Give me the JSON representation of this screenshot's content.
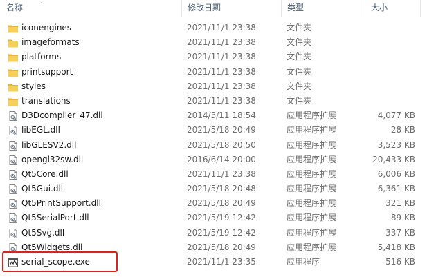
{
  "columns": {
    "name": "名称",
    "date": "修改日期",
    "type": "类型",
    "size": "大小"
  },
  "files": [
    {
      "name": "iconengines",
      "date": "2021/11/1 23:38",
      "type": "文件夹",
      "size": "",
      "icon": "folder-icon"
    },
    {
      "name": "imageformats",
      "date": "2021/11/1 23:38",
      "type": "文件夹",
      "size": "",
      "icon": "folder-icon"
    },
    {
      "name": "platforms",
      "date": "2021/11/1 23:38",
      "type": "文件夹",
      "size": "",
      "icon": "folder-icon"
    },
    {
      "name": "printsupport",
      "date": "2021/11/1 23:38",
      "type": "文件夹",
      "size": "",
      "icon": "folder-icon"
    },
    {
      "name": "styles",
      "date": "2021/11/1 23:38",
      "type": "文件夹",
      "size": "",
      "icon": "folder-icon"
    },
    {
      "name": "translations",
      "date": "2021/11/1 23:38",
      "type": "文件夹",
      "size": "",
      "icon": "folder-icon"
    },
    {
      "name": "D3Dcompiler_47.dll",
      "date": "2014/3/11 18:54",
      "type": "应用程序扩展",
      "size": "4,077 KB",
      "icon": "dll-file-icon"
    },
    {
      "name": "libEGL.dll",
      "date": "2021/5/18 20:49",
      "type": "应用程序扩展",
      "size": "28 KB",
      "icon": "dll-file-icon"
    },
    {
      "name": "libGLESV2.dll",
      "date": "2021/5/18 20:50",
      "type": "应用程序扩展",
      "size": "3,523 KB",
      "icon": "dll-file-icon"
    },
    {
      "name": "opengl32sw.dll",
      "date": "2016/6/14 20:00",
      "type": "应用程序扩展",
      "size": "20,433 KB",
      "icon": "dll-file-icon"
    },
    {
      "name": "Qt5Core.dll",
      "date": "2021/11/1 23:38",
      "type": "应用程序扩展",
      "size": "6,006 KB",
      "icon": "dll-file-icon"
    },
    {
      "name": "Qt5Gui.dll",
      "date": "2021/5/18 20:48",
      "type": "应用程序扩展",
      "size": "6,361 KB",
      "icon": "dll-file-icon"
    },
    {
      "name": "Qt5PrintSupport.dll",
      "date": "2021/5/18 20:49",
      "type": "应用程序扩展",
      "size": "321 KB",
      "icon": "dll-file-icon"
    },
    {
      "name": "Qt5SerialPort.dll",
      "date": "2021/5/19 12:42",
      "type": "应用程序扩展",
      "size": "89 KB",
      "icon": "dll-file-icon"
    },
    {
      "name": "Qt5Svg.dll",
      "date": "2021/5/19 12:42",
      "type": "应用程序扩展",
      "size": "337 KB",
      "icon": "dll-file-icon"
    },
    {
      "name": "Qt5Widgets.dll",
      "date": "2021/5/18 20:49",
      "type": "应用程序扩展",
      "size": "5,418 KB",
      "icon": "dll-file-icon"
    },
    {
      "name": "serial_scope.exe",
      "date": "2021/11/1 23:35",
      "type": "应用程序",
      "size": "516 KB",
      "icon": "exe-file-icon"
    }
  ],
  "colors": {
    "header_text": "#4c607a",
    "folder_yellow": "#f3c244",
    "highlight_red": "#e0201f"
  }
}
